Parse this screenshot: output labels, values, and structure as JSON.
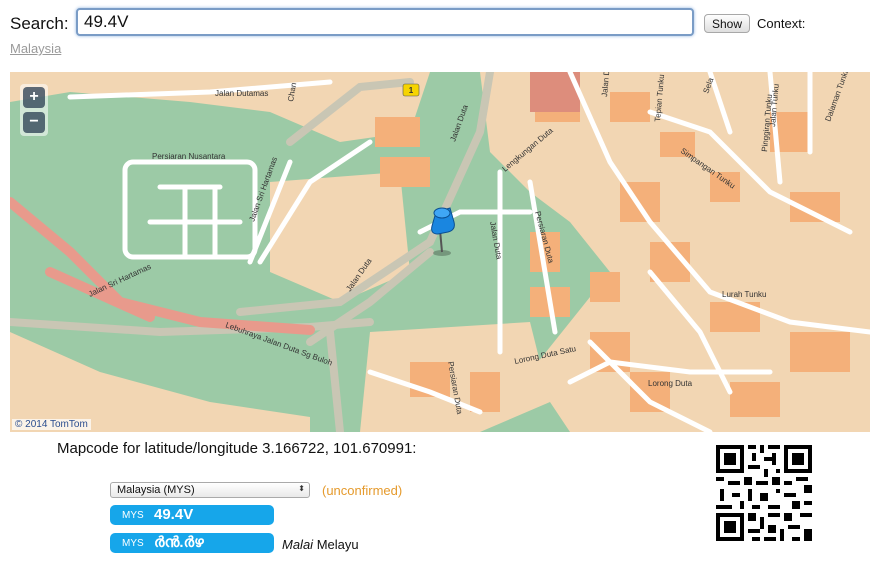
{
  "search": {
    "label": "Search:",
    "value": "49.4V",
    "show_label": "Show",
    "context_label": "Context:",
    "context_link": "Malaysia"
  },
  "map": {
    "zoom_in": "+",
    "zoom_out": "−",
    "attribution": "© 2014 TomTom",
    "route_shield": "1",
    "street_labels": [
      "Jalan Dutamas",
      "Persiaran Nusantara",
      "Jalan Sri Hartamas",
      "Jalan Duta",
      "Jalan Sri Hartamas",
      "Lebuhraya Jalan Duta Sg Buloh",
      "Jalan Duta",
      "Lengkungan Duta",
      "Jalan Duta",
      "Persiaran Duta",
      "Simpangan Tunku",
      "Lurah Tunku",
      "Lorong Duta Satu",
      "Persiaran Duta",
      "Lorong Duta",
      "Tepian Tunku",
      "Jalan Tunku",
      "Pinggiran Tunku",
      "Dalaman Tunku",
      "Chan",
      "Sela",
      "Jalan Duta"
    ]
  },
  "result": {
    "heading": "Mapcode for latitude/longitude 3.166722, 101.670991:",
    "country_select": "Malaysia (MYS)",
    "status": "(unconfirmed)",
    "codes": [
      {
        "territory": "MYS",
        "code": "49.4V"
      },
      {
        "territory": "MYS",
        "code": "ർൻ.ർഴ"
      }
    ],
    "language_native": "Malai",
    "language_name": "Melayu"
  },
  "colors": {
    "accent_pill": "#16a6ea",
    "unconfirmed": "#e59a2c",
    "map_green": "#9ccaa6",
    "map_orange": "#f4c08e"
  }
}
